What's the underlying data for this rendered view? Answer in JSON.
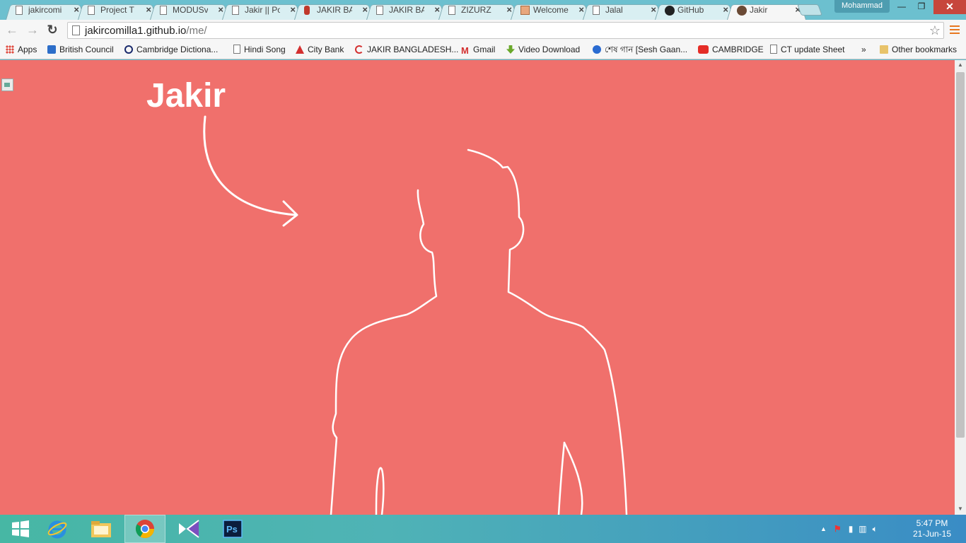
{
  "tabs": [
    {
      "title": "jakircomi",
      "icon": "page-icon"
    },
    {
      "title": "Project T",
      "icon": "page-icon"
    },
    {
      "title": "MODUSv",
      "icon": "page-icon"
    },
    {
      "title": "Jakir || Po",
      "icon": "page-icon"
    },
    {
      "title": "JAKIR BA",
      "icon": "java-icon"
    },
    {
      "title": "JAKIR BA",
      "icon": "page-icon"
    },
    {
      "title": "ZIZURZ",
      "icon": "page-icon"
    },
    {
      "title": "Welcome",
      "icon": "window-icon"
    },
    {
      "title": "Jalal",
      "icon": "page-icon"
    },
    {
      "title": "GitHub",
      "icon": "github-icon"
    },
    {
      "title": "Jakir",
      "icon": "avatar-icon"
    }
  ],
  "window": {
    "profile_name": "Mohammad",
    "minimize": "—",
    "restore": "❐",
    "close": "✕"
  },
  "toolbar": {
    "back": "←",
    "forward": "→",
    "reload": "↻",
    "url_host": "jakircomilla1.github.io",
    "url_path": "/me/",
    "star": "☆"
  },
  "bookmarks": {
    "apps": "Apps",
    "items": [
      "British Council",
      "Cambridge Dictiona...",
      "Hindi Song",
      "City Bank",
      "JAKIR BANGLADESH...",
      "Gmail",
      "Video Download",
      "শেষ গান [Sesh Gaan...",
      "CAMBRIDGE",
      "CT update Sheet"
    ],
    "overflow": "»",
    "other": "Other bookmarks"
  },
  "page": {
    "title": "Jakir",
    "background_color": "#f0706c"
  },
  "taskbar": {
    "time": "5:47 PM",
    "date": "21-Jun-15"
  }
}
